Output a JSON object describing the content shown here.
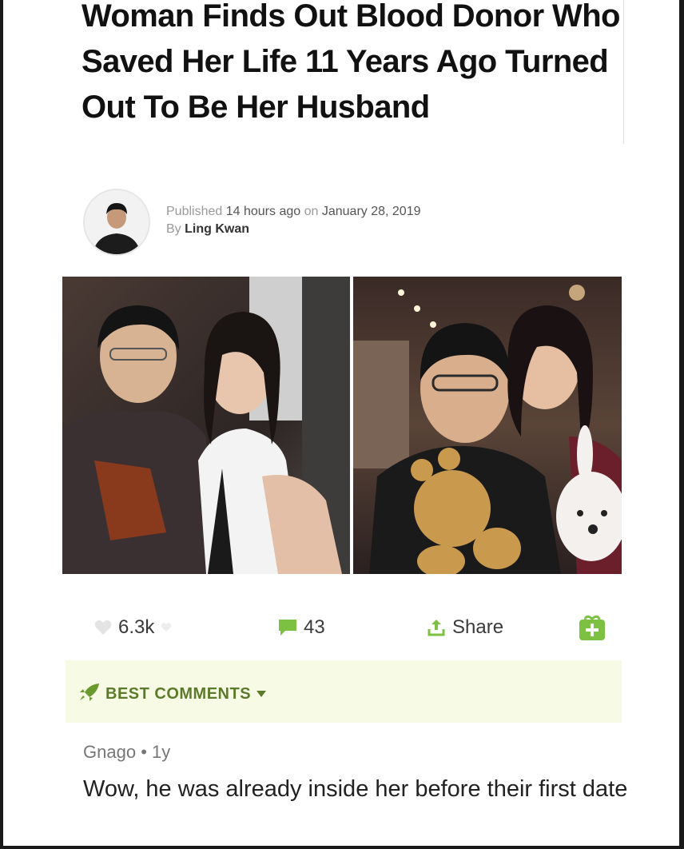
{
  "article": {
    "title": "Woman Finds Out Blood Donor Who Saved Her Life 11 Years Ago Turned Out To Be Her Husband",
    "published_prefix": "Published",
    "published_rel": "14 hours ago",
    "published_on": "on",
    "published_date": "January 28, 2019",
    "by_prefix": "By",
    "author_name": "Ling Kwan"
  },
  "actions": {
    "likes": "6.3k",
    "comments": "43",
    "share_label": "Share"
  },
  "best_comments": {
    "label": "BEST COMMENTS"
  },
  "comment": {
    "author": "Gnago",
    "separator": "•",
    "age": "1y",
    "text": "Wow, he was already inside her before their first date"
  },
  "colors": {
    "accent_green": "#7cc142",
    "best_bg": "#f7fbe6",
    "best_text": "#5c7b2a"
  },
  "icons": {
    "likes": "heart-icon",
    "comments": "comment-bubble-icon",
    "share": "share-arrow-icon",
    "add": "gift-box-icon",
    "best": "rocket-icon",
    "caret": "caret-down-icon"
  }
}
